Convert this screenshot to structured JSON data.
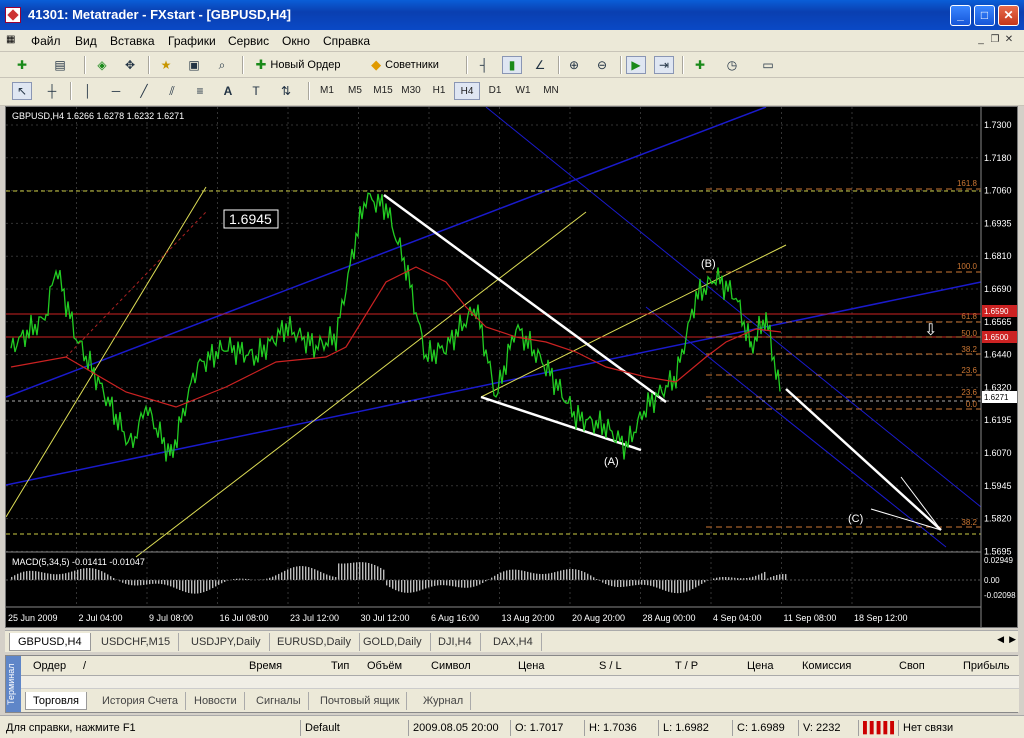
{
  "window": {
    "title": "41301: Metatrader - FXstart - [GBPUSD,H4]"
  },
  "menu": [
    "Файл",
    "Вид",
    "Вставка",
    "Графики",
    "Сервис",
    "Окно",
    "Справка"
  ],
  "toolbar1": {
    "new_order": "Новый Ордер",
    "experts": "Советники"
  },
  "timeframes": [
    "M1",
    "M5",
    "M15",
    "M30",
    "H1",
    "H4",
    "D1",
    "W1",
    "MN"
  ],
  "active_timeframe": "H4",
  "chart": {
    "info": "GBPUSD,H4  1.6266 1.6278 1.6232 1.6271",
    "price_label": "1.6945",
    "current_price": "1.6271",
    "price_ticks": [
      "1.7300",
      "1.7180",
      "1.7060",
      "1.6935",
      "1.6810",
      "1.6690",
      "1.6565",
      "1.6440",
      "1.6320",
      "1.6195",
      "1.6070",
      "1.5945",
      "1.5820",
      "1.5695"
    ],
    "red_labels": [
      "1.6590",
      "1.6500"
    ],
    "fib_labels": [
      "161.8",
      "100.0",
      "61.8",
      "50.0",
      "38.2",
      "23.6",
      "23.6",
      "0.0",
      "38.2"
    ],
    "wave_labels": [
      "(A)",
      "(B)",
      "(C)"
    ],
    "macd_info": "MACD(5,34,5) -0.01411 -0.01047",
    "macd_ticks": [
      "0.02949",
      "0.00",
      "-0.02098"
    ],
    "time_ticks": [
      "25 Jun 2009",
      "2 Jul 04:00",
      "9 Jul 08:00",
      "16 Jul 08:00",
      "23 Jul 12:00",
      "30 Jul 12:00",
      "6 Aug 16:00",
      "13 Aug 20:00",
      "20 Aug 20:00",
      "28 Aug 00:00",
      "4 Sep 04:00",
      "11 Sep 08:00",
      "18 Sep 12:00"
    ]
  },
  "chart_tabs": [
    "GBPUSD,H4",
    "USDCHF,M15",
    "USDJPY,Daily",
    "EURUSD,Daily",
    "GOLD,Daily",
    "DJI,H4",
    "DAX,H4"
  ],
  "terminal": {
    "side_label": "Терминал",
    "columns": [
      "Ордер",
      "/",
      "Время",
      "Тип",
      "Объём",
      "Символ",
      "Цена",
      "S / L",
      "T / P",
      "Цена",
      "Комиссия",
      "Своп",
      "Прибыль"
    ],
    "tabs": [
      "Торговля",
      "История Счета",
      "Новости",
      "Сигналы",
      "Почтовый ящик",
      "Журнал"
    ]
  },
  "status": {
    "help": "Для справки, нажмите F1",
    "profile": "Default",
    "datetime": "2009.08.05 20:00",
    "open": "O: 1.7017",
    "high": "H: 1.7036",
    "low": "L: 1.6982",
    "close": "C: 1.6989",
    "volume": "V: 2232",
    "connection": "Нет связи"
  },
  "colors": {
    "chart_bg": "#000000",
    "candles": "#22cc22",
    "grid": "#3a3a3a",
    "channel": "#0000cc",
    "trend": "#ffff66"
  }
}
